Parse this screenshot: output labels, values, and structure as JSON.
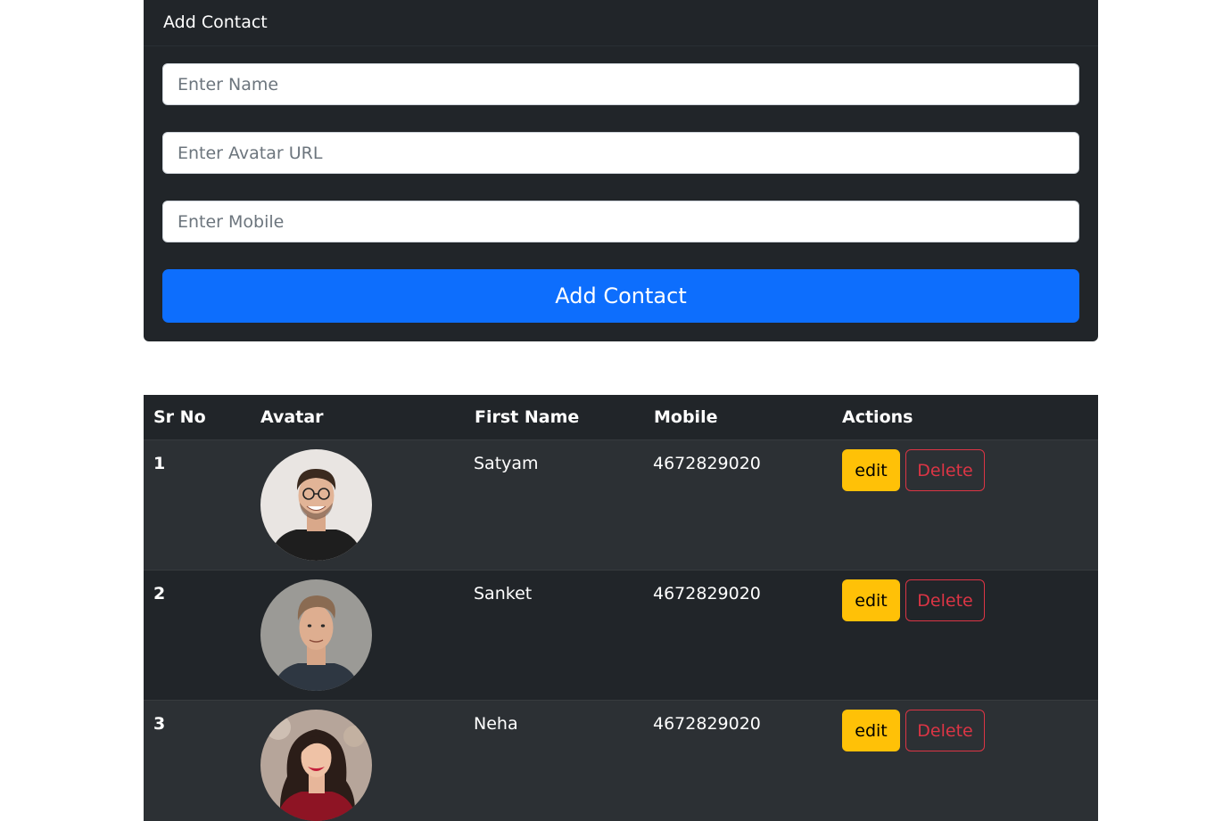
{
  "form": {
    "title": "Add Contact",
    "name_placeholder": "Enter Name",
    "avatar_placeholder": "Enter Avatar URL",
    "mobile_placeholder": "Enter Mobile",
    "submit_label": "Add Contact"
  },
  "table": {
    "headers": [
      "Sr No",
      "Avatar",
      "First Name",
      "Mobile",
      "Actions"
    ],
    "rows": [
      {
        "sr": "1",
        "name": "Satyam",
        "mobile": "4672829020",
        "edit": "edit",
        "delete": "Delete"
      },
      {
        "sr": "2",
        "name": "Sanket",
        "mobile": "4672829020",
        "edit": "edit",
        "delete": "Delete"
      },
      {
        "sr": "3",
        "name": "Neha",
        "mobile": "4672829020",
        "edit": "edit",
        "delete": "Delete"
      }
    ]
  },
  "colors": {
    "card_bg": "#212529",
    "primary": "#0d6efd",
    "warning": "#ffc107",
    "danger": "#dc3545"
  }
}
